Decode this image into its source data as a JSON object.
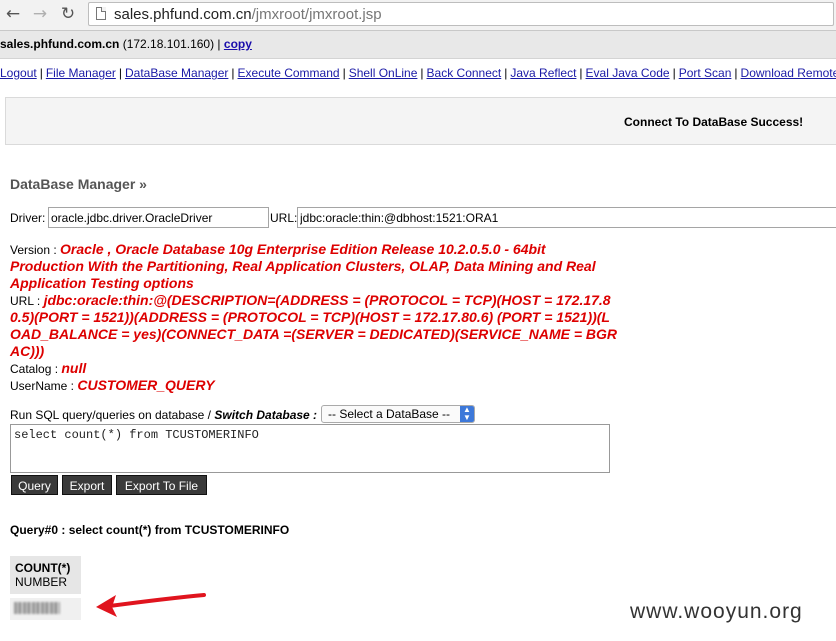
{
  "browser": {
    "url_host": "sales.phfund.com.cn",
    "url_path": "/jmxroot/jmxroot.jsp",
    "back_icon": "back-arrow-icon",
    "forward_icon": "forward-arrow-icon",
    "reload_icon": "reload-icon",
    "page_icon": "page-icon"
  },
  "hostbar": {
    "host": "sales.phfund.com.cn",
    "ip": " (172.18.101.160) | ",
    "copy_label": "copy"
  },
  "menu": [
    "Logout",
    "File Manager",
    "DataBase Manager",
    "Execute Command",
    "Shell OnLine",
    "Back Connect",
    "Java Reflect",
    "Eval Java Code",
    "Port Scan",
    "Download Remote File"
  ],
  "message": "Connect To DataBase Success!",
  "section_title": "DataBase Manager »",
  "driver": {
    "label": "Driver:",
    "value": "oracle.jdbc.driver.OracleDriver"
  },
  "url_field": {
    "label": "URL:",
    "value": "jdbc:oracle:thin:@dbhost:1521:ORA1"
  },
  "info": {
    "version_label": "Version : ",
    "version_value": "Oracle , Oracle Database 10g Enterprise Edition Release 10.2.0.5.0 - 64bit Production With the Partitioning, Real Application Clusters, OLAP, Data Mining and Real Application Testing options",
    "url_label": "URL : ",
    "url_value": "jdbc:oracle:thin:@(DESCRIPTION=(ADDRESS = (PROTOCOL = TCP)(HOST = 172.17.80.5)(PORT = 1521))(ADDRESS = (PROTOCOL = TCP)(HOST = 172.17.80.6) (PORT = 1521))(LOAD_BALANCE = yes)(CONNECT_DATA =(SERVER = DEDICATED)(SERVICE_NAME = BGRAC)))",
    "catalog_label": "Catalog : ",
    "catalog_value": "null",
    "username_label": "UserName : ",
    "username_value": "CUSTOMER_QUERY"
  },
  "sql": {
    "run_label": "Run SQL query/queries on database / ",
    "switch_label": "Switch Database :",
    "select_value": "-- Select a DataBase --",
    "query_text": "select count(*) from TCUSTOMERINFO"
  },
  "buttons": {
    "query": "Query",
    "export": "Export",
    "export_file": "Export To File"
  },
  "result": {
    "query_line": "Query#0 : select count(*) from TCUSTOMERINFO",
    "col_name": "COUNT(*)",
    "col_type": "NUMBER"
  },
  "watermark": "www.wooyun.org",
  "colors": {
    "value_red": "#dd0000",
    "link_blue": "#1a1aa6",
    "arrow_red": "#e0141e"
  }
}
